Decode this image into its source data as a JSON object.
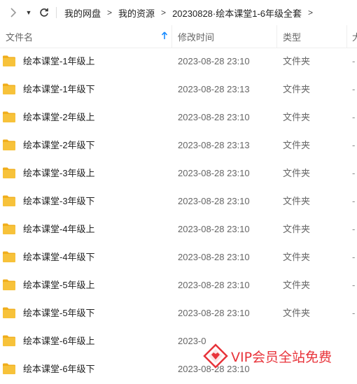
{
  "nav": {
    "breadcrumbs": [
      "我的网盘",
      "我的资源",
      "20230828·绘本课堂1-6年级全套"
    ]
  },
  "header": {
    "name": "文件名",
    "mtime": "修改时间",
    "type": "类型",
    "size": "大"
  },
  "rows": [
    {
      "name": "绘本课堂-1年级上",
      "time": "2023-08-28 23:10",
      "type": "文件夹",
      "size": "-"
    },
    {
      "name": "绘本课堂-1年级下",
      "time": "2023-08-28 23:13",
      "type": "文件夹",
      "size": "-"
    },
    {
      "name": "绘本课堂-2年级上",
      "time": "2023-08-28 23:10",
      "type": "文件夹",
      "size": "-"
    },
    {
      "name": "绘本课堂-2年级下",
      "time": "2023-08-28 23:13",
      "type": "文件夹",
      "size": "-"
    },
    {
      "name": "绘本课堂-3年级上",
      "time": "2023-08-28 23:10",
      "type": "文件夹",
      "size": "-"
    },
    {
      "name": "绘本课堂-3年级下",
      "time": "2023-08-28 23:10",
      "type": "文件夹",
      "size": "-"
    },
    {
      "name": "绘本课堂-4年级上",
      "time": "2023-08-28 23:10",
      "type": "文件夹",
      "size": "-"
    },
    {
      "name": "绘本课堂-4年级下",
      "time": "2023-08-28 23:10",
      "type": "文件夹",
      "size": "-"
    },
    {
      "name": "绘本课堂-5年级上",
      "time": "2023-08-28 23:10",
      "type": "文件夹",
      "size": "-"
    },
    {
      "name": "绘本课堂-5年级下",
      "time": "2023-08-28 23:10",
      "type": "文件夹",
      "size": "-"
    },
    {
      "name": "绘本课堂-6年级上",
      "time": "2023-0",
      "type": "",
      "size": ""
    },
    {
      "name": "绘本课堂-6年级下",
      "time": "2023-08-28 23:10",
      "type": "",
      "size": ""
    }
  ],
  "watermark": {
    "text": "VIP会员全站免费"
  },
  "colors": {
    "folder": "#f7c23a",
    "folder_tab": "#f0ae1c",
    "sort_arrow": "#1a8cff",
    "watermark": "#e8333a"
  },
  "icons": {
    "forward": "chevron-right-icon",
    "dropdown": "caret-down-icon",
    "refresh": "refresh-icon",
    "sort": "sort-up-icon",
    "folder": "folder-icon"
  }
}
